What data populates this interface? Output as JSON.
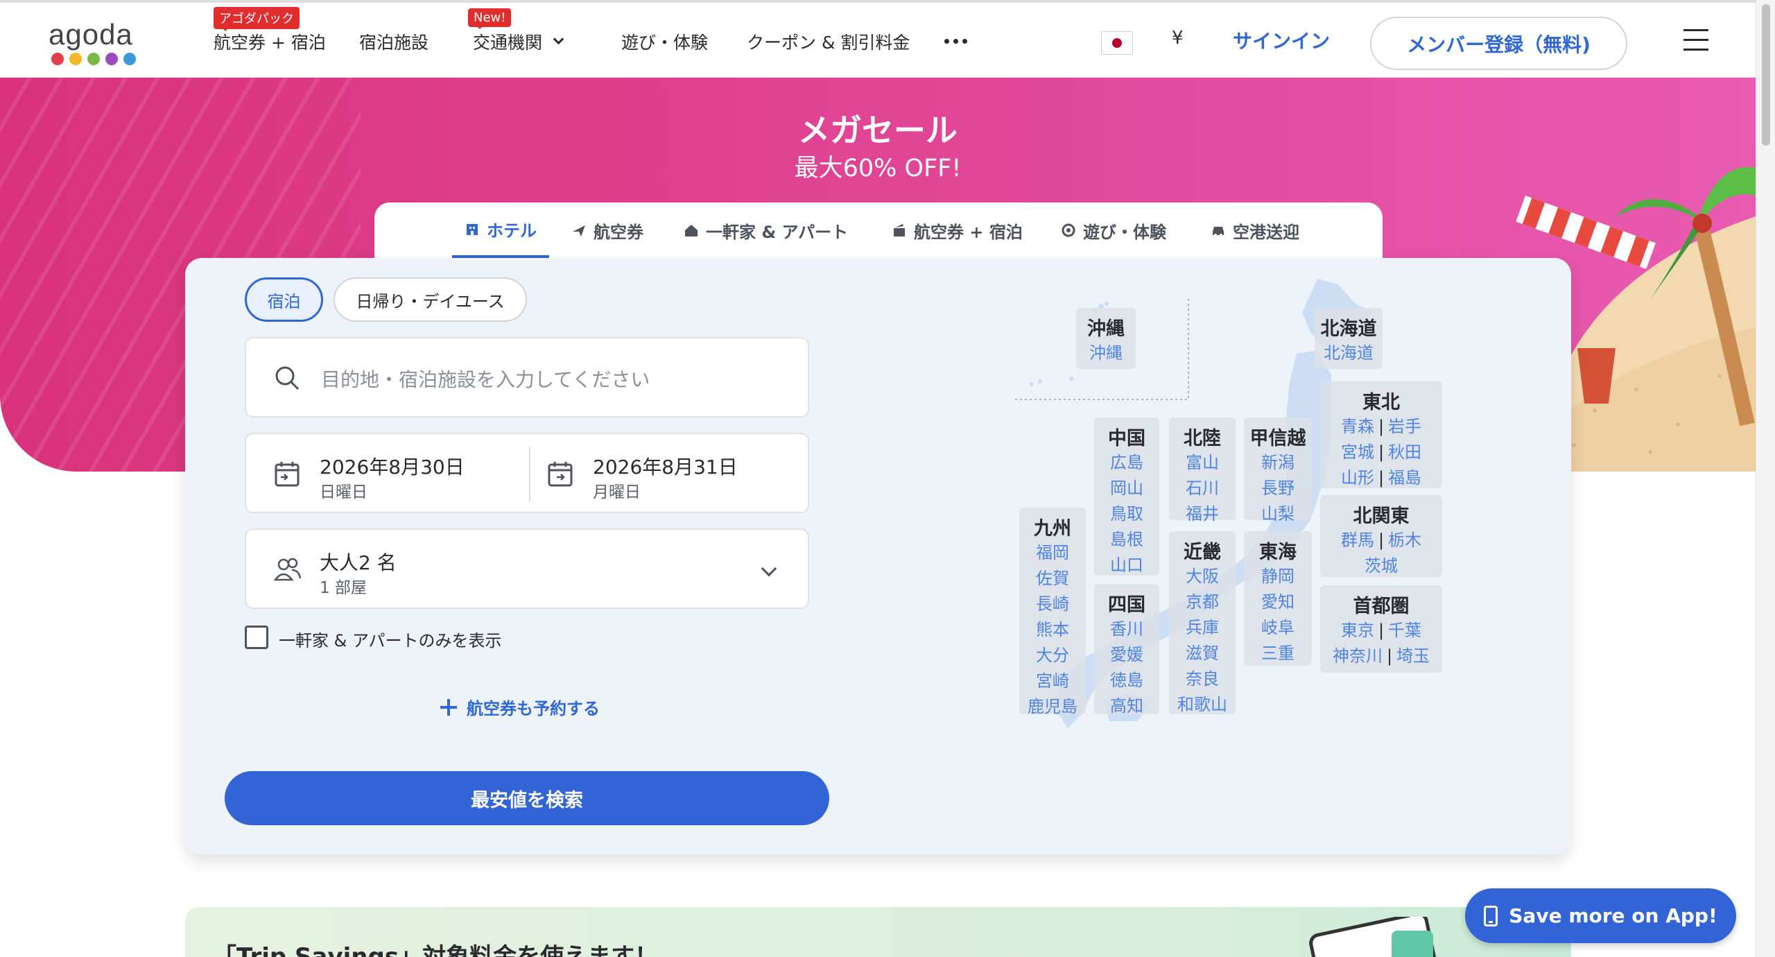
{
  "header": {
    "logo_text": "agoda",
    "logo_colors": [
      "#e24047",
      "#f5b62c",
      "#7ab648",
      "#9c4bbf",
      "#3a9ad9"
    ],
    "nav": [
      {
        "label": "航空券 + 宿泊",
        "badge": "アゴダパック"
      },
      {
        "label": "宿泊施設"
      },
      {
        "label": "交通機関",
        "badge": "New!"
      },
      {
        "label": "遊び・体験"
      },
      {
        "label": "クーポン & 割引料金"
      }
    ],
    "currency": "¥",
    "signin": "サインイン",
    "register": "メンバー登録（無料)"
  },
  "hero": {
    "title": "メガセール",
    "subtitle": "最大60% OFF!",
    "background_color": "#df3f8c"
  },
  "tabs": [
    {
      "label": "ホテル",
      "icon": "hotel-icon",
      "active": true
    },
    {
      "label": "航空券",
      "icon": "plane-icon"
    },
    {
      "label": "一軒家 & アパート",
      "icon": "house-icon"
    },
    {
      "label": "航空券 + 宿泊",
      "icon": "package-icon"
    },
    {
      "label": "遊び・体験",
      "icon": "activity-icon"
    },
    {
      "label": "空港送迎",
      "icon": "car-icon"
    }
  ],
  "search": {
    "stay_types": [
      "宿泊",
      "日帰り・デイユース"
    ],
    "destination_placeholder": "目的地・宿泊施設を入力してください",
    "checkin_date": "2026年8月30日",
    "checkin_day": "日曜日",
    "checkout_date": "2026年8月31日",
    "checkout_day": "月曜日",
    "guests": "大人2 名",
    "rooms": "1 部屋",
    "apartments_only_label": "一軒家 & アパートのみを表示",
    "add_flight_label": "航空券も予約する",
    "search_button": "最安値を検索"
  },
  "map": {
    "regions": {
      "okinawa": {
        "title": "沖縄",
        "prefs": [
          "沖縄"
        ]
      },
      "hokkaido": {
        "title": "北海道",
        "prefs": [
          "北海道"
        ]
      },
      "tohoku": {
        "title": "東北",
        "prefs": [
          "青森",
          "岩手",
          "宮城",
          "秋田",
          "山形",
          "福島"
        ]
      },
      "chugoku": {
        "title": "中国",
        "prefs": [
          "広島",
          "岡山",
          "鳥取",
          "島根",
          "山口"
        ]
      },
      "hokuriku": {
        "title": "北陸",
        "prefs": [
          "富山",
          "石川",
          "福井"
        ]
      },
      "koshinetsu": {
        "title": "甲信越",
        "prefs": [
          "新潟",
          "長野",
          "山梨"
        ]
      },
      "kitakanto": {
        "title": "北関東",
        "prefs": [
          "群馬",
          "栃木",
          "茨城"
        ]
      },
      "kyushu": {
        "title": "九州",
        "prefs": [
          "福岡",
          "佐賀",
          "長崎",
          "熊本",
          "大分",
          "宮崎",
          "鹿児島"
        ]
      },
      "kinki": {
        "title": "近畿",
        "prefs": [
          "大阪",
          "京都",
          "兵庫",
          "滋賀",
          "奈良",
          "和歌山"
        ]
      },
      "tokai": {
        "title": "東海",
        "prefs": [
          "静岡",
          "愛知",
          "岐阜",
          "三重"
        ]
      },
      "shikoku": {
        "title": "四国",
        "prefs": [
          "香川",
          "愛媛",
          "徳島",
          "高知"
        ]
      },
      "shutoken": {
        "title": "首都圏",
        "prefs": [
          "東京",
          "千葉",
          "神奈川",
          "埼玉"
        ]
      }
    }
  },
  "promo": {
    "text": "「Trip Savings」対象料金を使えます！"
  },
  "app_button": "Save more on App!",
  "colors": {
    "accent": "#3264d6",
    "link": "#4f84e0",
    "badge": "#e12d2d"
  }
}
